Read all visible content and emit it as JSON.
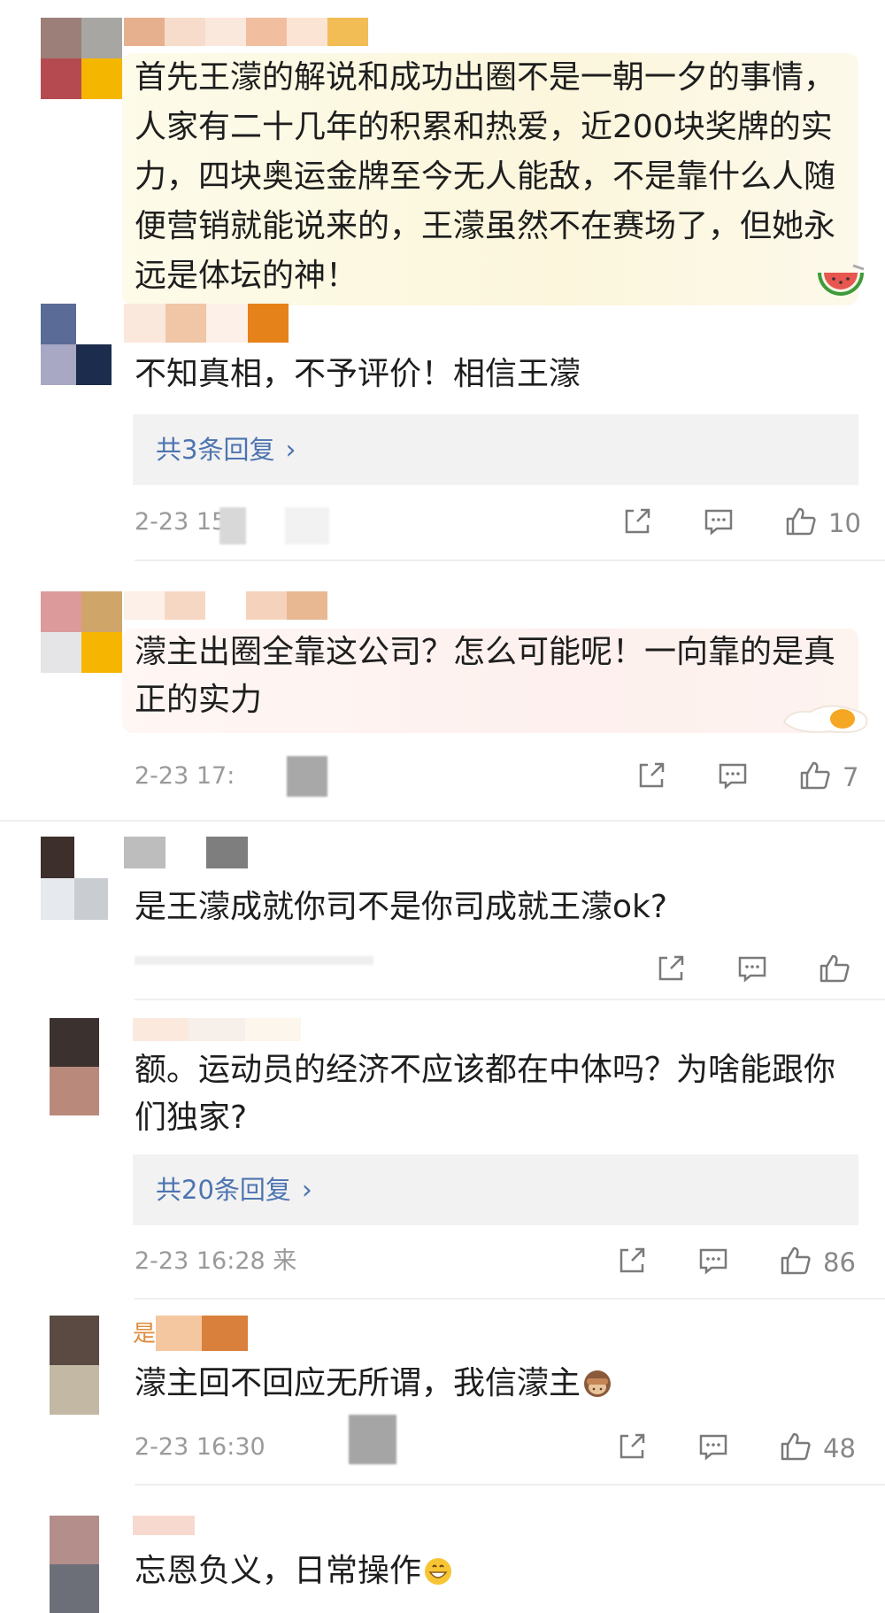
{
  "comments": [
    {
      "text": "首先王濛的解说和成功出圈不是一朝一夕的事情，人家有二十几年的积累和热爱，近200块奖牌的实力，四块奥运金牌至今无人能敌，不是靠什么人随便营销就能说来的，王濛虽然不在赛场了，但她永远是体坛的神！",
      "name": "",
      "meta": ""
    },
    {
      "text": "不知真相，不予评价！相信王濛",
      "replies": "共3条回复",
      "meta": "2-23 15",
      "likes": "10"
    },
    {
      "name_prefix": "",
      "text": "濛主出圈全靠这公司？怎么可能呢！一向靠的是真正的实力",
      "meta": "2-23 17:",
      "likes": "7"
    },
    {
      "text": "是王濛成就你司不是你司成就王濛ok?",
      "meta": "",
      "likes": ""
    },
    {
      "text": "额。运动员的经济不应该都在中体吗？为啥能跟你们独家?",
      "replies": "共20条回复",
      "meta": "2-23 16:28 来",
      "likes": "86"
    },
    {
      "name_prefix": "是",
      "text": "濛主回不回应无所谓，我信濛主",
      "meta": "2-23 16:30",
      "likes": "48"
    },
    {
      "text": "忘恩负义，日常操作"
    }
  ],
  "icons": {
    "share": "share-icon",
    "comment": "comment-icon",
    "like": "like-icon",
    "chevron": "chevron-right-icon"
  },
  "colors": {
    "link": "#4d74b0",
    "meta": "#9a9a9a",
    "reply_bg": "#f2f2f2"
  }
}
